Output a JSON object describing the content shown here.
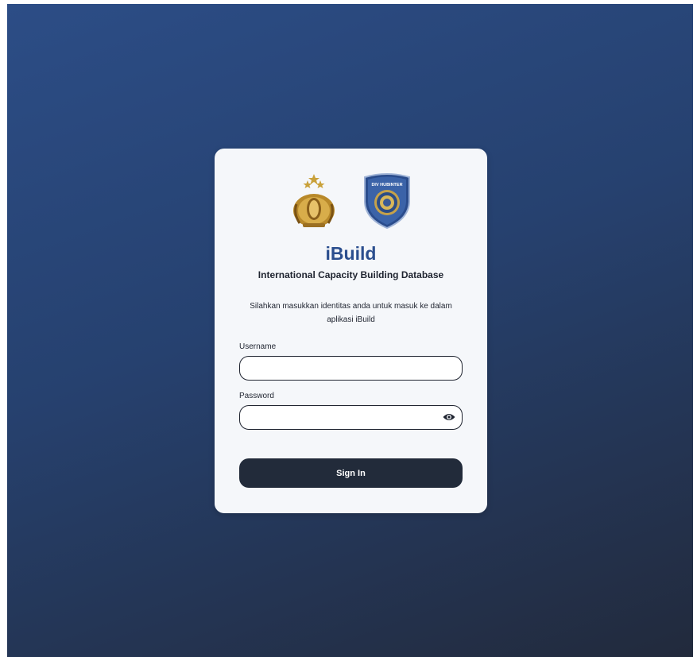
{
  "app": {
    "title": "iBuild",
    "subtitle": "International Capacity Building Database",
    "description": "Silahkan masukkan identitas anda untuk masuk ke dalam aplikasi iBuild"
  },
  "logos": {
    "left": {
      "icon": "police-emblem-icon"
    },
    "right": {
      "icon": "div-hubinter-badge-icon",
      "text": "DIV HUBINTER"
    }
  },
  "form": {
    "username_label": "Username",
    "username_value": "",
    "password_label": "Password",
    "password_value": "",
    "password_toggle_icon": "eye-icon",
    "submit_label": "Sign In"
  },
  "colors": {
    "background_start": "#2c4d86",
    "background_end": "#222a3c",
    "card": "#f5f7fa",
    "title": "#2b4e8e",
    "button": "#222b3a"
  }
}
